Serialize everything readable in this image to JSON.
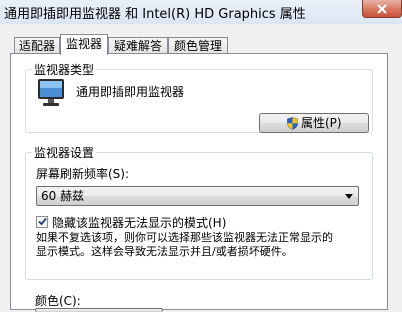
{
  "window": {
    "title": "通用即插即用监视器 和 Intel(R) HD Graphics 属性"
  },
  "tabs": [
    {
      "label": "适配器",
      "active": false
    },
    {
      "label": "监视器",
      "active": true
    },
    {
      "label": "疑难解答",
      "active": false
    },
    {
      "label": "颜色管理",
      "active": false
    }
  ],
  "monitor_type": {
    "group_title": "监视器类型",
    "monitor_name": "通用即插即用监视器",
    "properties_button": "属性(P)"
  },
  "monitor_settings": {
    "group_title": "监视器设置",
    "refresh_label": "屏幕刷新频率(S):",
    "refresh_value": "60 赫兹",
    "hide_modes_label": "隐藏该监视器无法显示的模式(H)",
    "hide_modes_checked": true,
    "help_line1": "如果不复选该项，则你可以选择那些该监视器无法正常显示的",
    "help_line2": "显示模式。这样会导致无法显示并且/或者损坏硬件。"
  },
  "colors": {
    "label": "颜色(C):"
  }
}
